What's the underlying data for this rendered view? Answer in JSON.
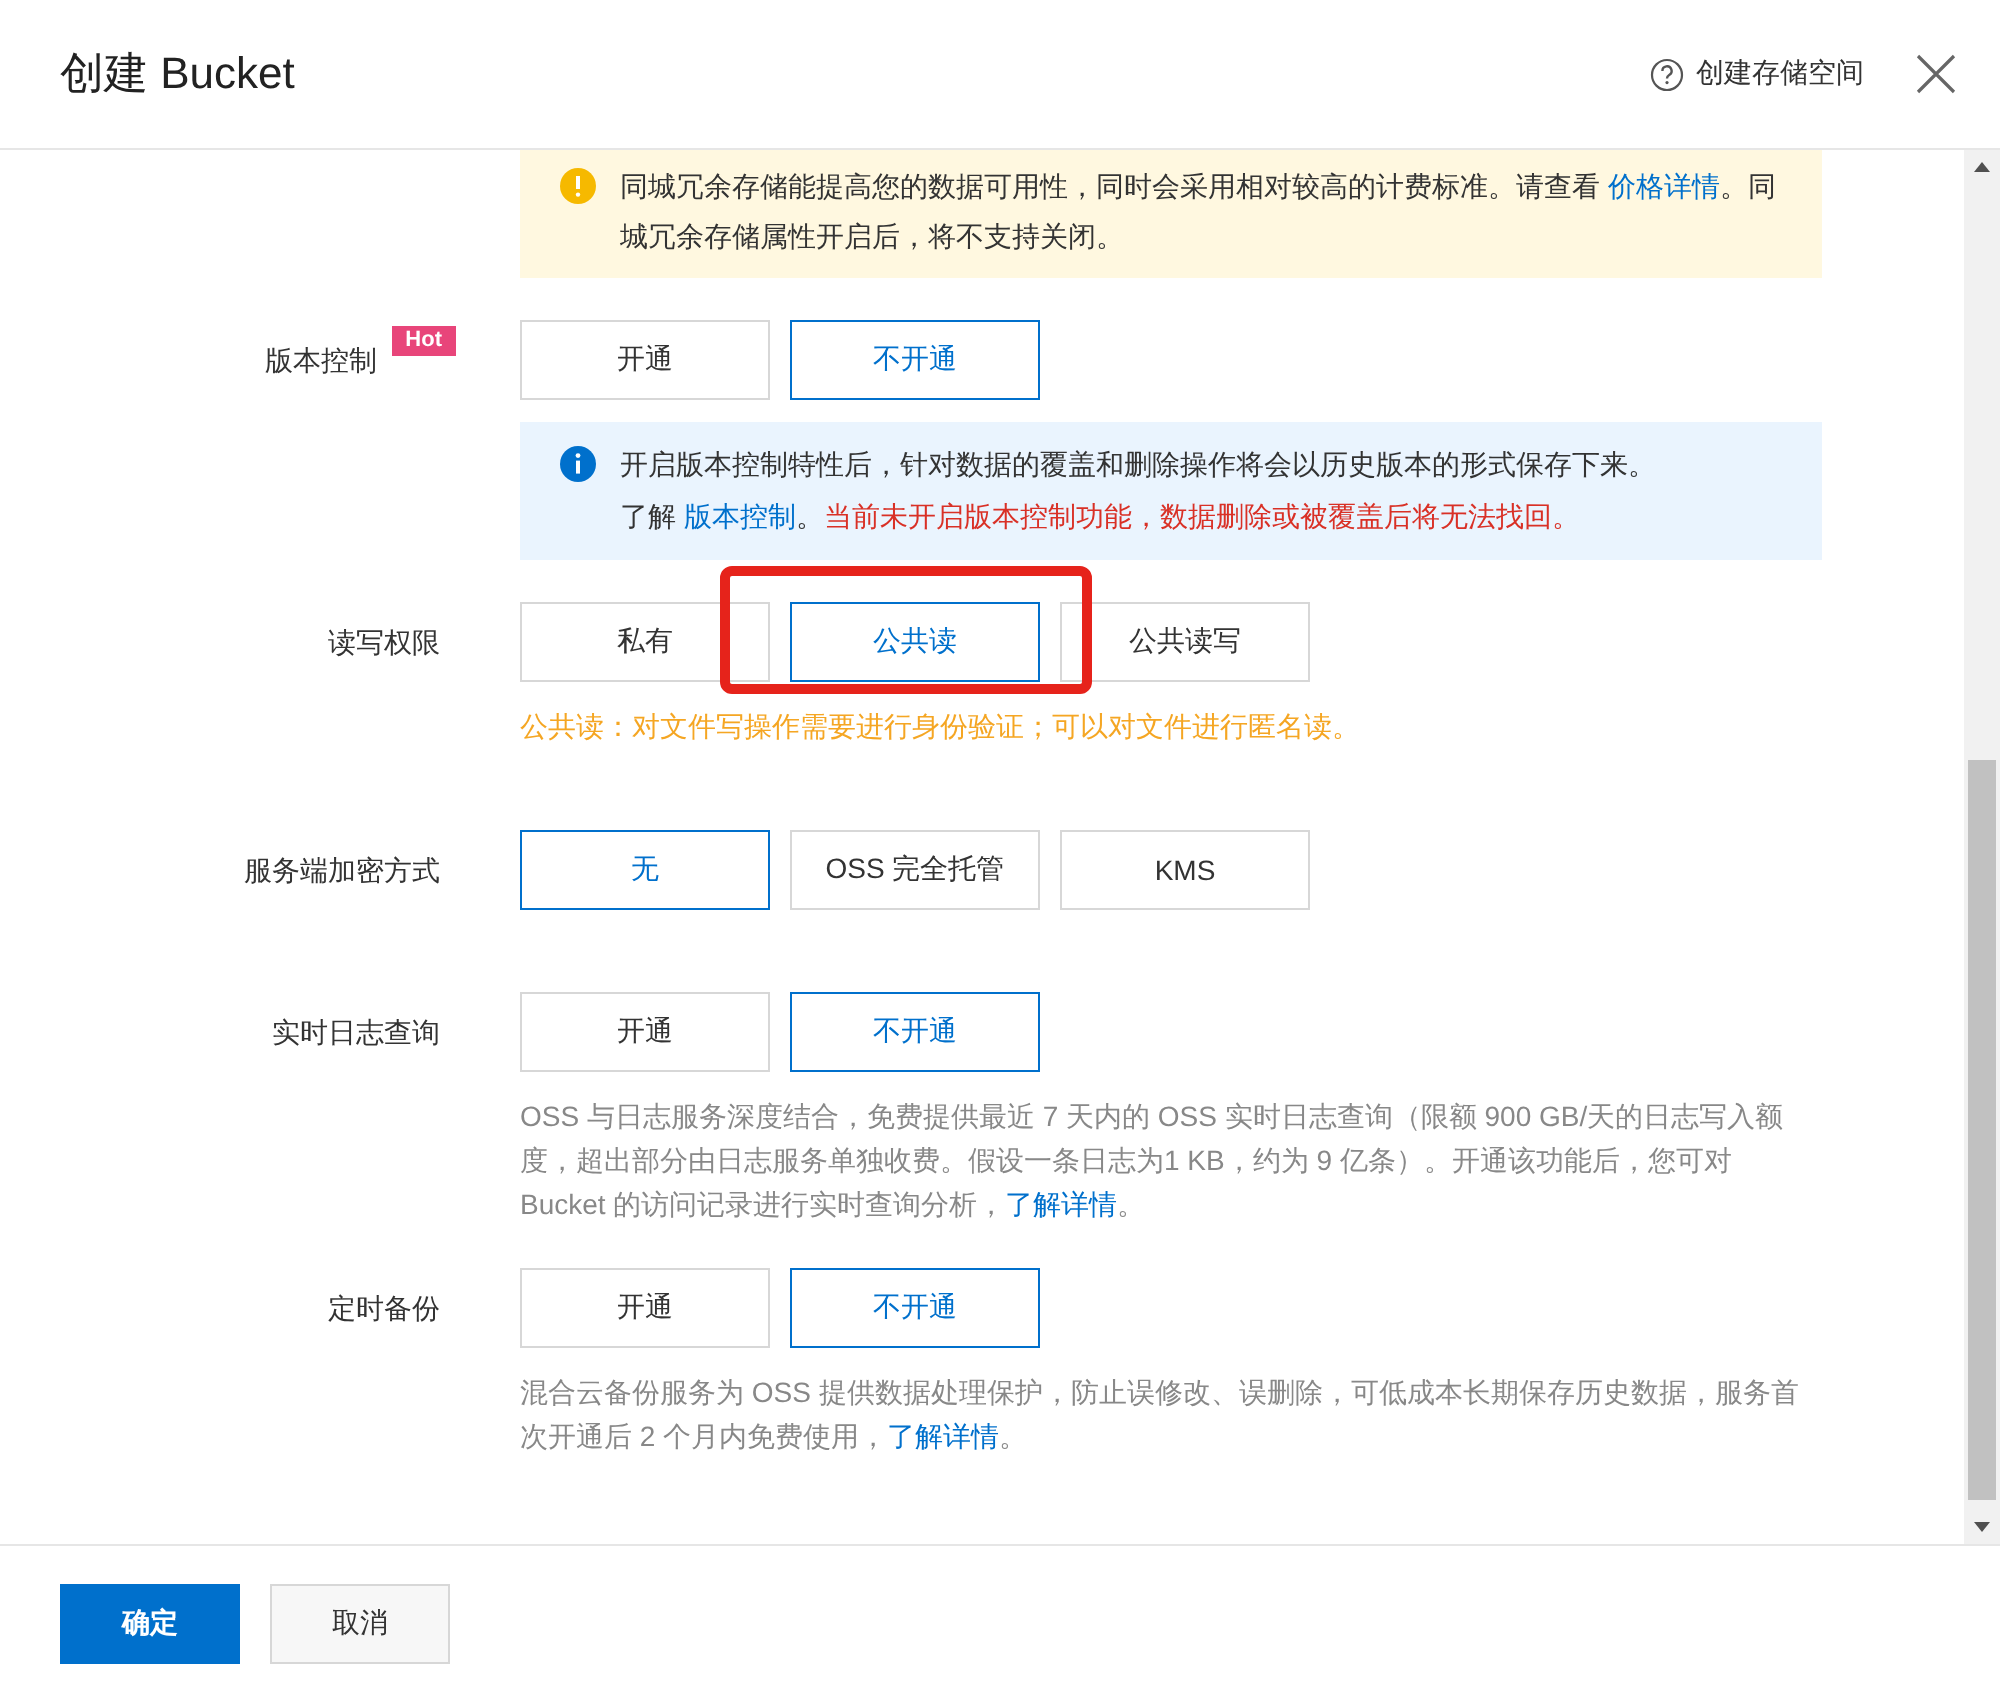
{
  "dialog": {
    "title": "创建 Bucket",
    "help_link": "创建存储空间"
  },
  "notice": {
    "kind": "warning",
    "parts": [
      {
        "kind": "plain",
        "text": "同城冗余存储能提高您的数据可用性，同时会采用相对较高的计费标准。请查看 "
      },
      {
        "kind": "link",
        "text": "价格详情"
      },
      {
        "kind": "plain",
        "text": "。同城冗余存储属性开启后，将不支持关闭。"
      }
    ]
  },
  "sections": [
    {
      "label": "版本控制",
      "badge": "Hot",
      "options": [
        {
          "label": "开通",
          "selected": false
        },
        {
          "label": "不开通",
          "selected": true
        }
      ],
      "notes": [
        {
          "kind": "info",
          "lines": [
            [
              {
                "kind": "plain",
                "text": "开启版本控制特性后，针对数据的覆盖和删除操作将会以历史版本的形式保存下来。"
              }
            ],
            [
              {
                "kind": "plain",
                "text": "了解 "
              },
              {
                "kind": "link",
                "text": "版本控制"
              },
              {
                "kind": "plain",
                "text": "。"
              },
              {
                "kind": "danger",
                "text": "当前未开启版本控制功能，数据删除或被覆盖后将无法找回。"
              }
            ]
          ]
        }
      ]
    },
    {
      "label": "读写权限",
      "annotation": {
        "kind": "highlight-box"
      },
      "options": [
        {
          "label": "私有",
          "selected": false
        },
        {
          "label": "公共读",
          "selected": true
        },
        {
          "label": "公共读写",
          "selected": false
        }
      ],
      "notes": [
        {
          "kind": "hint",
          "parts": [
            {
              "kind": "plain",
              "text": "公共读：对文件写操作需要进行身份验证；可以对文件进行匿名读。"
            }
          ]
        }
      ]
    },
    {
      "label": "服务端加密方式",
      "options": [
        {
          "label": "无",
          "selected": true
        },
        {
          "label": "OSS 完全托管",
          "selected": false
        },
        {
          "label": "KMS",
          "selected": false
        }
      ]
    },
    {
      "label": "实时日志查询",
      "options": [
        {
          "label": "开通",
          "selected": false
        },
        {
          "label": "不开通",
          "selected": true
        }
      ],
      "notes": [
        {
          "kind": "description",
          "parts": [
            {
              "kind": "plain",
              "text": "OSS 与日志服务深度结合，免费提供最近 7 天内的 OSS 实时日志查询（限额 900 GB/天的日志写入额度，超出部分由日志服务单独收费。假设一条日志为1 KB，约为 9 亿条）。开通该功能后，您可对 Bucket 的访问记录进行实时查询分析，"
            },
            {
              "kind": "link",
              "text": "了解详情"
            },
            {
              "kind": "plain",
              "text": "。"
            }
          ]
        }
      ]
    },
    {
      "label": "定时备份",
      "options": [
        {
          "label": "开通",
          "selected": false
        },
        {
          "label": "不开通",
          "selected": true
        }
      ],
      "notes": [
        {
          "kind": "description",
          "parts": [
            {
              "kind": "plain",
              "text": "混合云备份服务为 OSS 提供数据处理保护，防止误修改、误删除，可低成本长期保存历史数据，服务首次开通后 2 个月内免费使用，"
            },
            {
              "kind": "link",
              "text": "了解详情"
            },
            {
              "kind": "plain",
              "text": "。"
            }
          ]
        }
      ]
    }
  ],
  "footer": {
    "buttons": [
      {
        "label": "确定",
        "kind": "primary"
      },
      {
        "label": "取消",
        "kind": "secondary"
      }
    ]
  }
}
